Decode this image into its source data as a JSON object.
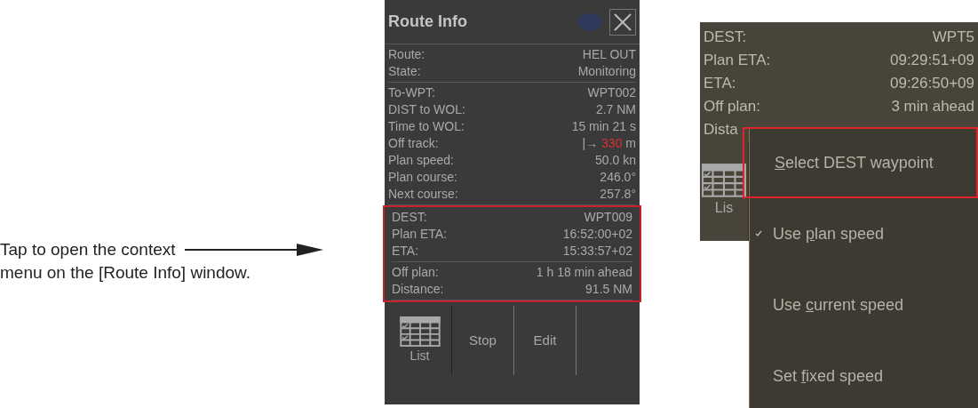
{
  "annotation": {
    "lines": [
      "Tap to open the context",
      "menu on the [Route Info] window."
    ]
  },
  "route_info": {
    "title": "Route Info",
    "sections": [
      {
        "highlighted": false,
        "rows": [
          {
            "label": "Route:",
            "value": "HEL OUT"
          },
          {
            "label": "State:",
            "value": "Monitoring"
          }
        ]
      },
      {
        "highlighted": false,
        "rows": [
          {
            "label": "To-WPT:",
            "value": "WPT002"
          },
          {
            "label": "DIST to WOL:",
            "value": "2.7 NM"
          },
          {
            "label": "Time to WOL:",
            "value": "15 min 21 s"
          },
          {
            "label": "Off track:",
            "value_parts": [
              {
                "text": "|→",
                "alert": false
              },
              {
                "text": "330",
                "alert": true
              },
              {
                "text": "m",
                "alert": false
              }
            ]
          },
          {
            "label": "Plan speed:",
            "value": "50.0 kn"
          },
          {
            "label": "Plan course:",
            "value": "246.0°"
          },
          {
            "label": "Next course:",
            "value": "257.8°"
          }
        ]
      },
      {
        "highlighted": true,
        "rows": [
          {
            "label": "DEST:",
            "value": "WPT009"
          },
          {
            "label": "Plan ETA:",
            "value": "16:52:00+02"
          },
          {
            "label": "ETA:",
            "value": "15:33:57+02"
          }
        ]
      },
      {
        "highlighted": true,
        "rows": [
          {
            "label": "Off plan:",
            "value": "1 h 18 min ahead"
          },
          {
            "label": "Distance:",
            "value": "91.5 NM"
          }
        ]
      }
    ],
    "buttons": [
      {
        "label": "List",
        "kind": "icon"
      },
      {
        "label": "Stop",
        "kind": "text"
      },
      {
        "label": "Edit",
        "kind": "text"
      }
    ]
  },
  "context_view": {
    "rows": [
      {
        "label": "DEST:",
        "value": "WPT5"
      },
      {
        "label": "Plan ETA:",
        "value": "09:29:51+09"
      },
      {
        "label": "ETA:",
        "value": "09:26:50+09"
      },
      {
        "label": "Off plan:",
        "value": "3 min ahead"
      },
      {
        "label": "Dista"
      }
    ],
    "buttons": [
      {
        "label": "Lis",
        "kind": "icon"
      }
    ],
    "menu": [
      {
        "key": "S",
        "after": "elect DEST waypoint",
        "checked": false,
        "highlighted": true
      },
      {
        "before": "Use ",
        "key": "p",
        "after": "lan speed",
        "checked": true,
        "highlighted": false
      },
      {
        "before": "Use ",
        "key": "c",
        "after": "urrent speed",
        "checked": false,
        "highlighted": false
      },
      {
        "before": "Set ",
        "key": "f",
        "after": "ixed speed",
        "checked": false,
        "highlighted": false
      }
    ]
  }
}
